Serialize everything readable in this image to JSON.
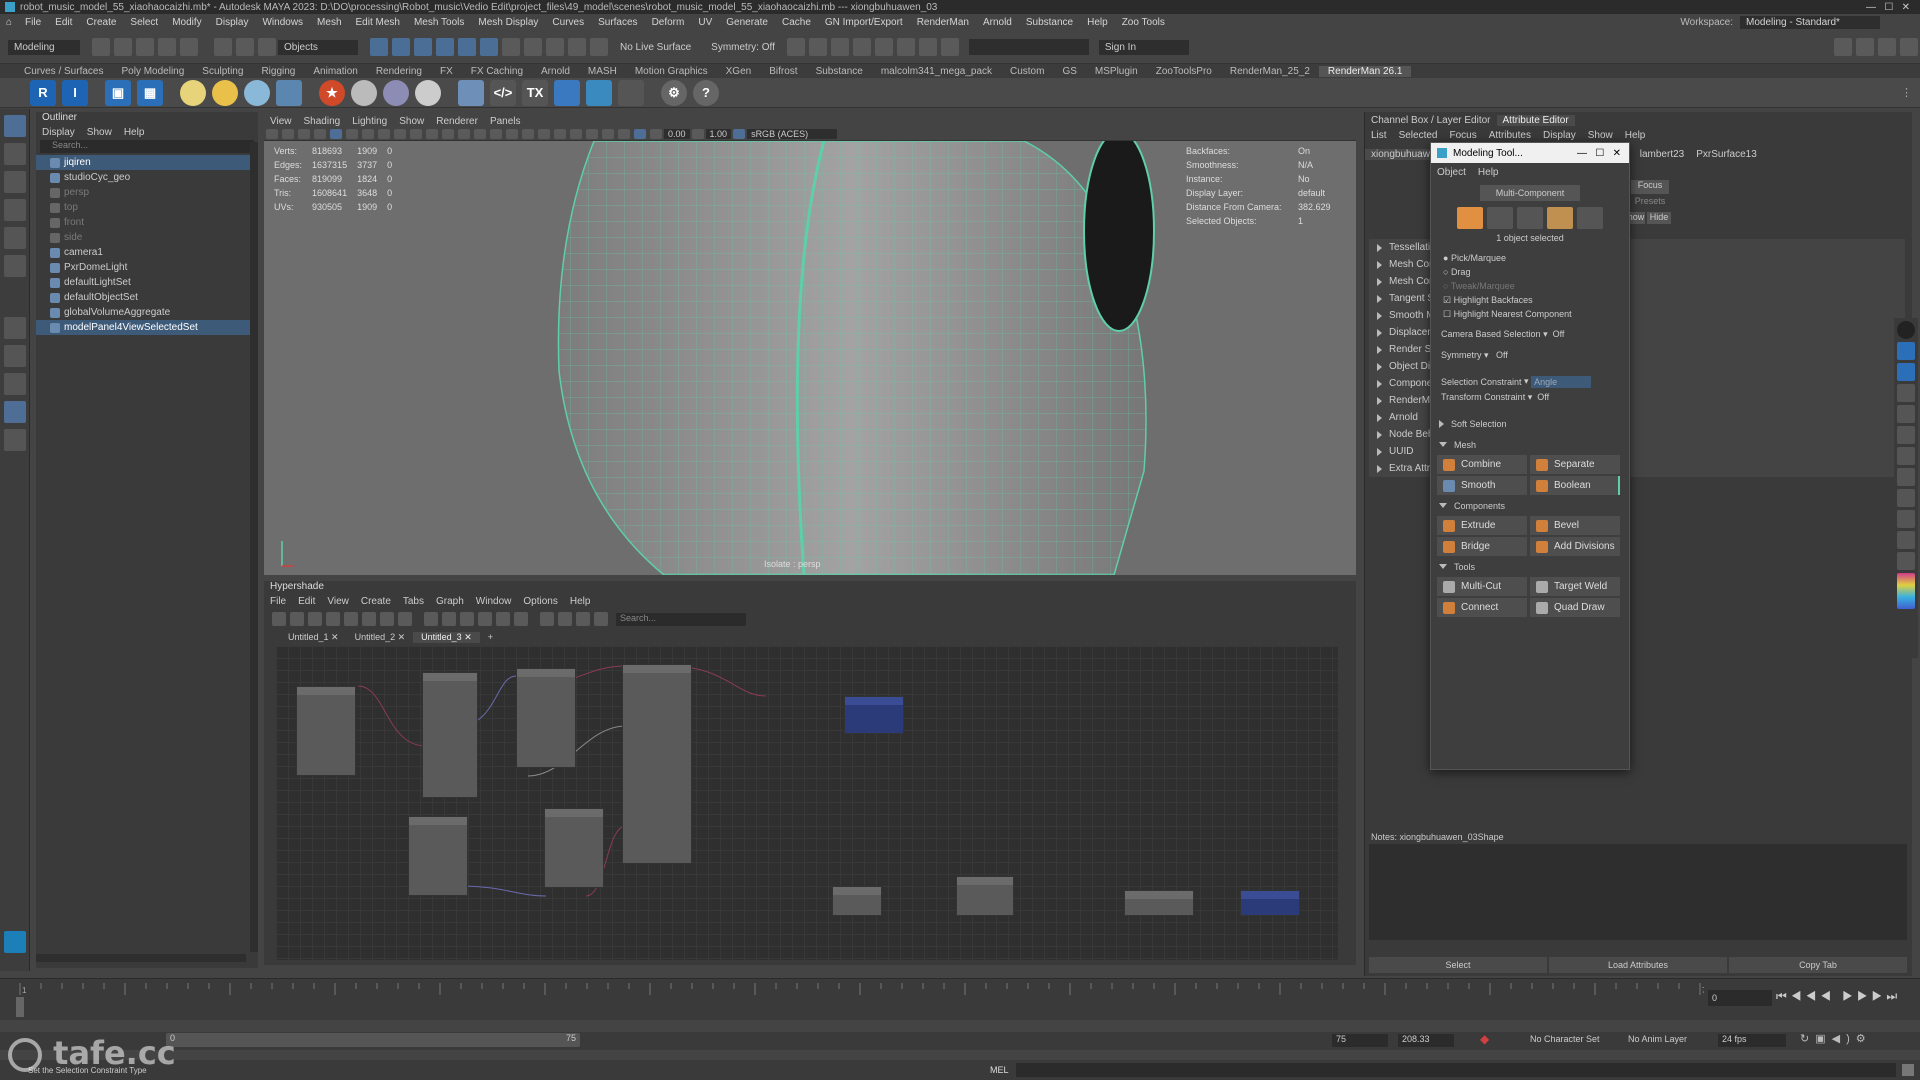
{
  "title": "robot_music_model_55_xiaohaocaizhi.mb* - Autodesk MAYA 2023: D:\\DO\\processing\\Robot_music\\Vedio Edit\\project_files\\49_model\\scenes\\robot_music_model_55_xiaohaocaizhi.mb  ---  xiongbuhuawen_03",
  "menus": [
    "File",
    "Edit",
    "Create",
    "Select",
    "Modify",
    "Display",
    "Windows",
    "Mesh",
    "Edit Mesh",
    "Mesh Tools",
    "Mesh Display",
    "Curves",
    "Surfaces",
    "Deform",
    "UV",
    "Generate",
    "Cache",
    "GN Import/Export",
    "RenderMan",
    "Arnold",
    "Substance",
    "Help",
    "Zoo Tools"
  ],
  "workspace": {
    "label": "Workspace:",
    "value": "Modeling - Standard*"
  },
  "status": {
    "mode": "Modeling",
    "objects": "Objects",
    "live": "No Live Surface",
    "symmetry": "Symmetry: Off",
    "signin": "Sign In"
  },
  "shelf_tabs": [
    "Curves / Surfaces",
    "Poly Modeling",
    "Sculpting",
    "Rigging",
    "Animation",
    "Rendering",
    "FX",
    "FX Caching",
    "Arnold",
    "MASH",
    "Motion Graphics",
    "XGen",
    "Bifrost",
    "Substance",
    "malcolm341_mega_pack",
    "Custom",
    "GS",
    "MSPlugin",
    "ZooToolsPro",
    "RenderMan_25_2",
    "RenderMan 26.1"
  ],
  "shelf_active": "RenderMan 26.1",
  "outliner": {
    "title": "Outliner",
    "menus": [
      "Display",
      "Show",
      "Help"
    ],
    "search": "Search...",
    "items": [
      {
        "label": "jiqiren",
        "sel": true,
        "indent": 1
      },
      {
        "label": "studioCyc_geo",
        "sel": false,
        "indent": 1
      },
      {
        "label": "persp",
        "sel": false,
        "indent": 1,
        "dim": true
      },
      {
        "label": "top",
        "sel": false,
        "indent": 1,
        "dim": true
      },
      {
        "label": "front",
        "sel": false,
        "indent": 1,
        "dim": true
      },
      {
        "label": "side",
        "sel": false,
        "indent": 1,
        "dim": true
      },
      {
        "label": "camera1",
        "sel": false,
        "indent": 1
      },
      {
        "label": "PxrDomeLight",
        "sel": false,
        "indent": 1
      },
      {
        "label": "defaultLightSet",
        "sel": false,
        "indent": 1
      },
      {
        "label": "defaultObjectSet",
        "sel": false,
        "indent": 1
      },
      {
        "label": "globalVolumeAggregate",
        "sel": false,
        "indent": 1
      },
      {
        "label": "modelPanel4ViewSelectedSet",
        "sel": true,
        "indent": 1
      }
    ]
  },
  "viewport": {
    "menus": [
      "View",
      "Shading",
      "Lighting",
      "Show",
      "Renderer",
      "Panels"
    ],
    "exposure": "0.00",
    "gamma": "1.00",
    "colorspace": "sRGB (ACES)",
    "label": "Isolate : persp",
    "stats": [
      {
        "k": "Verts:",
        "a": "818693",
        "b": "1909",
        "c": "0"
      },
      {
        "k": "Edges:",
        "a": "1637315",
        "b": "3737",
        "c": "0"
      },
      {
        "k": "Faces:",
        "a": "819099",
        "b": "1824",
        "c": "0"
      },
      {
        "k": "Tris:",
        "a": "1608641",
        "b": "3648",
        "c": "0"
      },
      {
        "k": "UVs:",
        "a": "930505",
        "b": "1909",
        "c": "0"
      }
    ],
    "info": [
      {
        "k": "Backfaces:",
        "v": "On"
      },
      {
        "k": "Smoothness:",
        "v": "N/A"
      },
      {
        "k": "Instance:",
        "v": "No"
      },
      {
        "k": "Display Layer:",
        "v": "default"
      },
      {
        "k": "Distance From Camera:",
        "v": "382.629"
      },
      {
        "k": "Selected Objects:",
        "v": "1"
      }
    ]
  },
  "hypershade": {
    "title": "Hypershade",
    "menus": [
      "File",
      "Edit",
      "View",
      "Create",
      "Tabs",
      "Graph",
      "Window",
      "Options",
      "Help"
    ],
    "search": "Search...",
    "tabs": [
      "Untitled_1",
      "Untitled_2",
      "Untitled_3"
    ],
    "active_tab": "Untitled_3"
  },
  "attr_editor": {
    "tabs": [
      "Channel Box / Layer Editor",
      "Attribute Editor"
    ],
    "menus": [
      "List",
      "Selected",
      "Focus",
      "Attributes",
      "Display",
      "Show",
      "Help"
    ],
    "node_tabs": [
      "xiongbuhuawen_03",
      "lambert23",
      "PxrSurface13"
    ],
    "focus": "Focus",
    "presets": "Presets",
    "show": "Show",
    "hide": "Hide",
    "sections": [
      "Tessellation",
      "Mesh Component Display",
      "Mesh Controls",
      "Tangent Space",
      "Smooth Mesh",
      "Displacement Map",
      "Render Stats",
      "Object Display",
      "Components",
      "RenderMan",
      "Arnold",
      "Node Behavior",
      "UUID",
      "Extra Attributes"
    ],
    "notes": "Notes:  xiongbuhuawen_03Shape",
    "buttons": [
      "Select",
      "Load Attributes",
      "Copy Tab"
    ]
  },
  "modeling_toolkit": {
    "title": "Modeling Tool...",
    "menus": [
      "Object",
      "Help"
    ],
    "mode": "Multi-Component",
    "selected": "1 object selected",
    "pick": [
      "Pick/Marquee",
      "Drag",
      "Tweak/Marquee"
    ],
    "highlight_backfaces": "Highlight Backfaces",
    "highlight_nearest": "Highlight Nearest Component",
    "camera_based": "Camera Based Selection",
    "camera_based_val": "Off",
    "symmetry": "Symmetry",
    "symmetry_val": "Off",
    "sel_constraint": "Selection Constraint",
    "sel_constraint_val": "Angle",
    "transform_constraint": "Transform Constraint",
    "transform_constraint_val": "Off",
    "soft_selection": "Soft Selection",
    "mesh_hdr": "Mesh",
    "mesh": [
      "Combine",
      "Separate",
      "Smooth",
      "Boolean"
    ],
    "components_hdr": "Components",
    "components": [
      "Extrude",
      "Bevel",
      "Bridge",
      "Add Divisions"
    ],
    "tools_hdr": "Tools",
    "tools": [
      "Multi-Cut",
      "Target Weld",
      "Connect",
      "Quad Draw"
    ]
  },
  "timeline": {
    "ticks": [
      "1",
      "",
      "",
      "",
      "",
      "",
      "",
      "",
      "",
      "",
      "",
      "",
      "",
      "",
      "",
      "",
      "",
      "",
      "",
      "",
      "",
      "",
      "",
      "",
      "",
      "",
      "",
      "",
      "",
      "",
      "",
      "",
      "",
      "",
      "",
      "",
      "",
      "",
      "",
      "",
      "",
      "",
      "",
      "",
      "",
      "",
      "",
      "",
      "",
      "",
      "",
      "",
      "",
      "",
      "",
      "",
      "",
      "",
      "",
      "",
      "",
      "",
      "",
      "",
      "",
      "",
      "",
      "",
      "",
      "",
      "",
      "",
      "",
      "",
      "",
      "",
      "",
      "",
      "",
      "",
      "75"
    ],
    "current_frame": "0",
    "range_start": "0",
    "range_end": "75",
    "anim_end": "75",
    "max_end": "208.33",
    "char_set": "No Character Set",
    "anim_layer": "No Anim Layer",
    "fps": "24 fps"
  },
  "helpline": "Set the Selection Constraint Type",
  "mel": "MEL",
  "watermark": "tafe.cc",
  "colors": {
    "accent": "#5ecfa8",
    "selection": "#3e5a79",
    "bg": "#444444",
    "panel": "#3a3a3a"
  }
}
